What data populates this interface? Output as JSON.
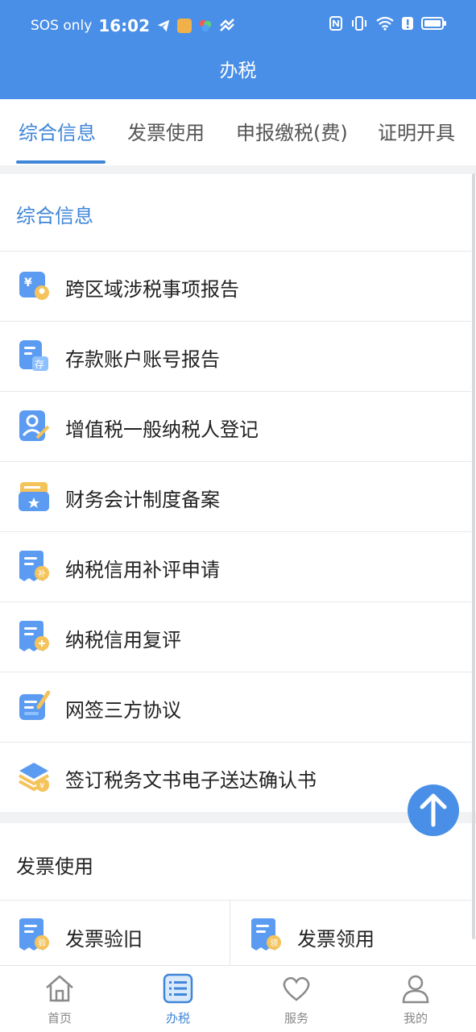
{
  "status": {
    "left_text": "SOS only",
    "time": "16:02"
  },
  "header": {
    "title": "办税"
  },
  "tabs": [
    {
      "label": "综合信息",
      "active": true
    },
    {
      "label": "发票使用",
      "active": false
    },
    {
      "label": "申报缴税(费)",
      "active": false
    },
    {
      "label": "证明开具",
      "active": false
    }
  ],
  "sections": {
    "general": {
      "title": "综合信息",
      "items": [
        {
          "label": "跨区域涉税事项报告",
          "icon": "cross-region-report-icon"
        },
        {
          "label": "存款账户账号报告",
          "icon": "deposit-account-icon"
        },
        {
          "label": "增值税一般纳税人登记",
          "icon": "vat-taxpayer-icon"
        },
        {
          "label": "财务会计制度备案",
          "icon": "accounting-folder-icon"
        },
        {
          "label": "纳税信用补评申请",
          "icon": "credit-supplement-icon"
        },
        {
          "label": "纳税信用复评",
          "icon": "credit-review-icon"
        },
        {
          "label": "网签三方协议",
          "icon": "online-agreement-icon"
        },
        {
          "label": "签订税务文书电子送达确认书",
          "icon": "e-delivery-icon"
        }
      ]
    },
    "invoice": {
      "title": "发票使用",
      "items": [
        {
          "label": "发票验旧",
          "icon": "invoice-verify-icon"
        },
        {
          "label": "发票领用",
          "icon": "invoice-receive-icon"
        }
      ]
    }
  },
  "nav": [
    {
      "label": "首页",
      "icon": "home-icon",
      "active": false
    },
    {
      "label": "办税",
      "icon": "tax-list-icon",
      "active": true
    },
    {
      "label": "服务",
      "icon": "heart-icon",
      "active": false
    },
    {
      "label": "我的",
      "icon": "user-icon",
      "active": false
    }
  ],
  "colors": {
    "primary": "#4a8fe7",
    "accent_text": "#3f86d8",
    "background_strip": "#f1f2f4"
  }
}
